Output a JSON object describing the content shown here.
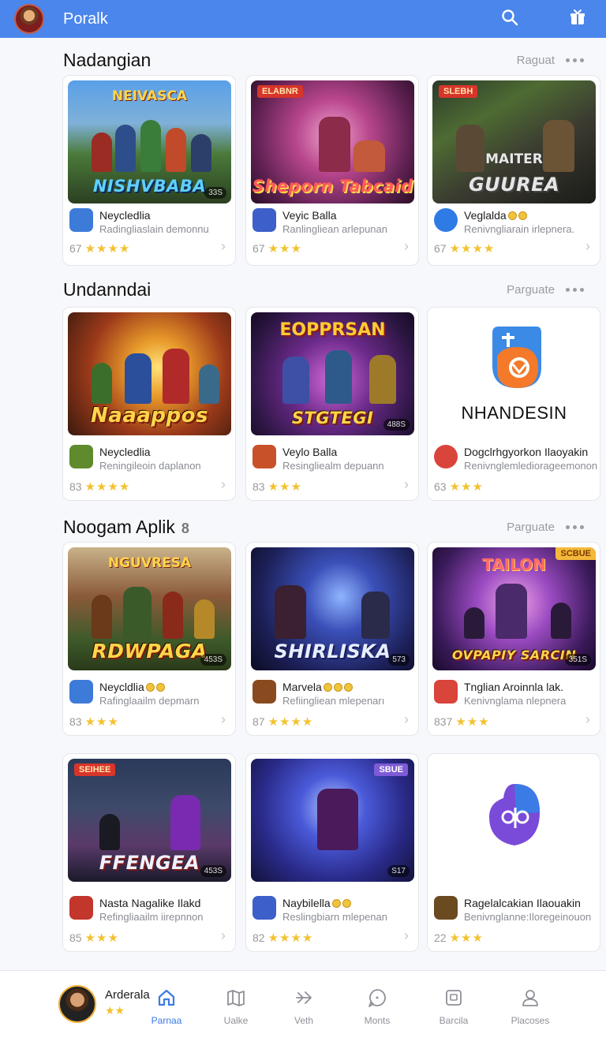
{
  "app": {
    "title": "Poralk"
  },
  "sections": [
    {
      "title": "Nadangian",
      "badge": "",
      "action": "Raguat",
      "cards": [
        {
          "thumb_top": "NEIVASCA",
          "thumb_title": "NISHVBABA",
          "tag": "",
          "size": "33S",
          "name": "Neycledlia",
          "sub": "Radingliaslain demonnu",
          "rating": "67",
          "stars": "★★★★",
          "icon_color": "#3d7bd9"
        },
        {
          "thumb_top": "",
          "thumb_title": "Sheporn Tabcaid",
          "tag": "ELABNR",
          "size": "",
          "name": "Veyic Balla",
          "sub": "Ranlingliean arlepunan",
          "rating": "67",
          "stars": "★★★",
          "icon_color": "#3d5fc9"
        },
        {
          "thumb_top": "MAITER",
          "thumb_title": "GUUREA",
          "tag": "SLEBH",
          "size": "",
          "name": "Veglalda",
          "sub": "Renivngliarain irlepnera.",
          "rating": "67",
          "stars": "★★★★",
          "icon_color": "#2f7be6"
        }
      ]
    },
    {
      "title": "Undanndai",
      "badge": "",
      "action": "Parguate",
      "cards": [
        {
          "thumb_top": "",
          "thumb_title": "Naaappos",
          "tag": "",
          "size": "",
          "name": "Neycledlia",
          "sub": "Reningileoin daplanon",
          "rating": "83",
          "stars": "★★★★",
          "icon_color": "#5f8b2c"
        },
        {
          "thumb_top": "EOPPRSAN",
          "thumb_title": "STGTEGI",
          "tag": "",
          "size": "488S",
          "name": "Veylo Balla",
          "sub": "Resingliealm depuann",
          "rating": "83",
          "stars": "★★★",
          "icon_color": "#c8512a"
        },
        {
          "logo": true,
          "logo_word": "NHANDESIN",
          "name": "Dogclrhgyorkon Ilaoyakin",
          "sub": "Renivnglemlediorageemonon",
          "rating": "63",
          "stars": "★★★",
          "icon_color": "#d9443b"
        }
      ]
    },
    {
      "title": "Noogam Aplik",
      "badge": "8",
      "action": "Parguate",
      "cards": [
        {
          "thumb_top": "NGUVRESA",
          "thumb_title": "RDWPAGA",
          "tag": "",
          "size": "453S",
          "name": "Neycldlia",
          "coins": true,
          "sub": "Rafinglaailm depmarn",
          "rating": "83",
          "stars": "★★★",
          "icon_color": "#3d7bd9"
        },
        {
          "thumb_top": "",
          "thumb_title": "SHIRLISKA",
          "tag": "",
          "size": "573",
          "name": "Marvela",
          "coins": true,
          "sub": "Refiingliean mlepenarı",
          "rating": "87",
          "stars": "★★★★",
          "icon_color": "#8a4a1f"
        },
        {
          "thumb_top": "TAILON",
          "thumb_title": "OVPAPIY SARCIN",
          "tag": "SCBUE",
          "tag_style": "gold",
          "size": "351S",
          "name": "Tnglian Aroinnla lak.",
          "sub": "Kenivnglama nlepnera",
          "rating": "837",
          "stars": "★★★",
          "icon_color": "#d9443b"
        }
      ]
    },
    {
      "title": "",
      "badge": "",
      "action": "",
      "cards": [
        {
          "thumb_top": "",
          "thumb_title": "FFENGEA",
          "tag": "SEIHEE",
          "size": "453S",
          "name": "Nasta Nagalike Ilakd",
          "sub": "Refingliaailm iirepnnon",
          "rating": "85",
          "stars": "★★★",
          "icon_color": "#c3362c"
        },
        {
          "thumb_top": "",
          "thumb_title": "",
          "tag": "SBUE",
          "tag_style": "violet",
          "size": "S17",
          "name": "Naybilella",
          "coins": true,
          "sub": "Reslingbiarn mlepenan",
          "rating": "82",
          "stars": "★★★★",
          "icon_color": "#3d5fc9"
        },
        {
          "logo": true,
          "logo_word": "",
          "name": "Ragelalcakian Ilaouakin",
          "sub": "Benivnglanne:Iloregeinouon",
          "rating": "22",
          "stars": "★★★",
          "icon_color": "#6b4a1f"
        }
      ]
    }
  ],
  "profile": {
    "name": "Arderala",
    "stars": "★★"
  },
  "nav": [
    {
      "label": "Parnaa",
      "icon": "home-icon"
    },
    {
      "label": "Ualke",
      "icon": "map-icon"
    },
    {
      "label": "Veth",
      "icon": "arrow-icon"
    },
    {
      "label": "Monts",
      "icon": "chat-icon"
    },
    {
      "label": "Barcila",
      "icon": "square-icon"
    },
    {
      "label": "Placoses",
      "icon": "person-icon"
    }
  ],
  "colors": {
    "topbar": "#4a86ec",
    "accent": "#3b7be3",
    "star": "#f2c230"
  }
}
